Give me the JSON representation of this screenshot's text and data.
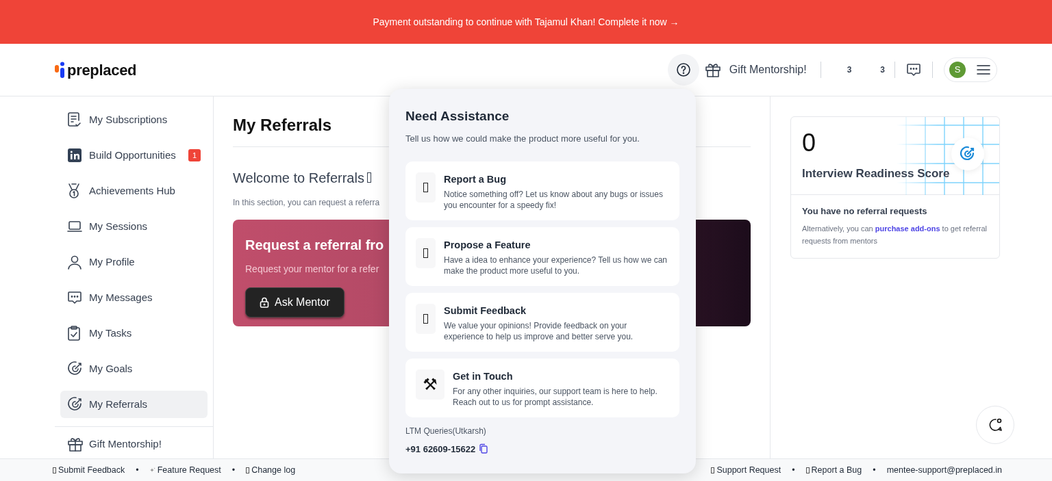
{
  "banner": {
    "text": "Payment outstanding to continue with Tajamul Khan! Complete it now →"
  },
  "header": {
    "logo": "preplaced",
    "help_button": {
      "active": true
    },
    "gift_label": "Gift Mentorship!",
    "counts": [
      "3",
      "3"
    ],
    "avatar_initial": "S"
  },
  "sidebar": {
    "items": [
      {
        "label": "My Subscriptions",
        "selected": false
      },
      {
        "label": "Build Opportunities",
        "selected": false,
        "badge": "1"
      },
      {
        "label": "Achievements Hub",
        "selected": false
      },
      {
        "label": "My Sessions",
        "selected": false
      },
      {
        "label": "My Profile",
        "selected": false
      },
      {
        "label": "My Messages",
        "selected": false
      },
      {
        "label": "My Tasks",
        "selected": false
      },
      {
        "label": "My Goals",
        "selected": false
      },
      {
        "label": "My Referrals",
        "selected": true
      }
    ],
    "bottom_item": {
      "label": "Gift Mentorship!"
    }
  },
  "main": {
    "title": "My Referrals",
    "welcome": "Welcome to Referrals",
    "intro": "In this section, you can request a referra",
    "card": {
      "title": "Request a referral fro",
      "subtitle": "Request your mentor for a refer",
      "button": "Ask Mentor"
    }
  },
  "score_card": {
    "score": "0",
    "label": "Interview Readiness Score",
    "empty_title": "You have no referral requests",
    "empty_before": "Alternatively, you can ",
    "empty_link": "purchase add-ons",
    "empty_after": " to get referral requests from mentors"
  },
  "assistance_popup": {
    "title": "Need Assistance",
    "subtitle": "Tell us how we could make the product more useful for you.",
    "options": [
      {
        "title": "Report a Bug",
        "description": "Notice something off? Let us know about any bugs or issues you encounter for a speedy fix!"
      },
      {
        "title": "Propose a Feature",
        "description": "Have a idea to enhance your experience? Tell us how we can make the product more useful to you."
      },
      {
        "title": "Submit Feedback",
        "description": "We value your opinions! Provide feedback on your experience to help us improve and better serve you."
      },
      {
        "title": "Get in Touch",
        "description": "For any other inquiries, our support team is here to help. Reach out to us for prompt assistance.",
        "icon": "⚒"
      }
    ],
    "contact_label": "LTM Queries(Utkarsh)",
    "phone": "+91 62609-15622"
  },
  "footer": {
    "separator": "•",
    "left_links": [
      {
        "label": "Submit Feedback"
      },
      {
        "label": "Feature Request"
      },
      {
        "label": "Change log"
      }
    ],
    "right_links": [
      {
        "label": "Support Request"
      },
      {
        "label": "Report a Bug"
      },
      {
        "label": "mentee-support@preplaced.in"
      }
    ]
  }
}
